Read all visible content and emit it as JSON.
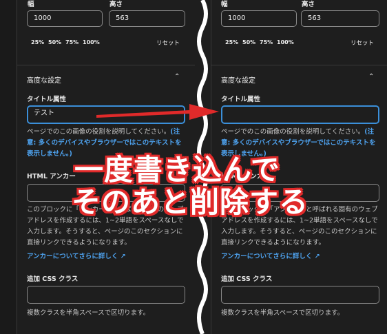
{
  "left": {
    "width_label": "幅",
    "height_label": "高さ",
    "width_value": "1000",
    "height_value": "563",
    "scale_options": [
      "25%",
      "50%",
      "75%",
      "100%"
    ],
    "reset_label": "リセット",
    "advanced_title": "高度な設定",
    "title_attr_label": "タイトル属性",
    "title_attr_value": "テスト",
    "help_text_1": "ページでのこの画像の役割を説明してください。",
    "help_link": "(注意: 多くのデバイスやブラウザーではこのテキストを表示しません。)",
    "anchor_label": "HTML アンカー",
    "anchor_help": "このブロックに「アンカー」と呼ばれる固有のウェブアドレスを作成するには、1~2単語をスペースなしで入力します。そうすると、ページのこのセクションに直接リンクできるようになります。",
    "anchor_more": "アンカーについてさらに詳しく",
    "css_label": "追加 CSS クラス",
    "css_help": "複数クラスを半角スペースで区切ります。"
  },
  "right": {
    "width_label": "幅",
    "height_label": "高さ",
    "width_value": "1000",
    "height_value": "563",
    "scale_options": [
      "25%",
      "50%",
      "75%",
      "100%"
    ],
    "reset_label": "リセット",
    "advanced_title": "高度な設定",
    "title_attr_label": "タイトル属性",
    "title_attr_value": "",
    "help_text_1": "ページでのこの画像の役割を説明してください。",
    "help_link": "(注意: 多くのデバイスやブラウザーではこのテキストを表示しません。)",
    "anchor_label": "HTML アンカー",
    "anchor_help": "このブロックに「アンカー」と呼ばれる固有のウェブアドレスを作成するには、1~2単語をスペースなしで入力します。そうすると、ページのこのセクションに直接リンクできるようになります。",
    "anchor_more": "アンカーについてさらに詳しく",
    "css_label": "追加 CSS クラス",
    "css_help": "複数クラスを半角スペースで区切ります。"
  },
  "annotation": {
    "line1": "一度書き込んで",
    "line2": "そのあと削除する",
    "color": "#e02a2a"
  },
  "colors": {
    "background": "#1e1e1e",
    "focus": "#3b8fd9",
    "link": "#4ea3f0"
  }
}
